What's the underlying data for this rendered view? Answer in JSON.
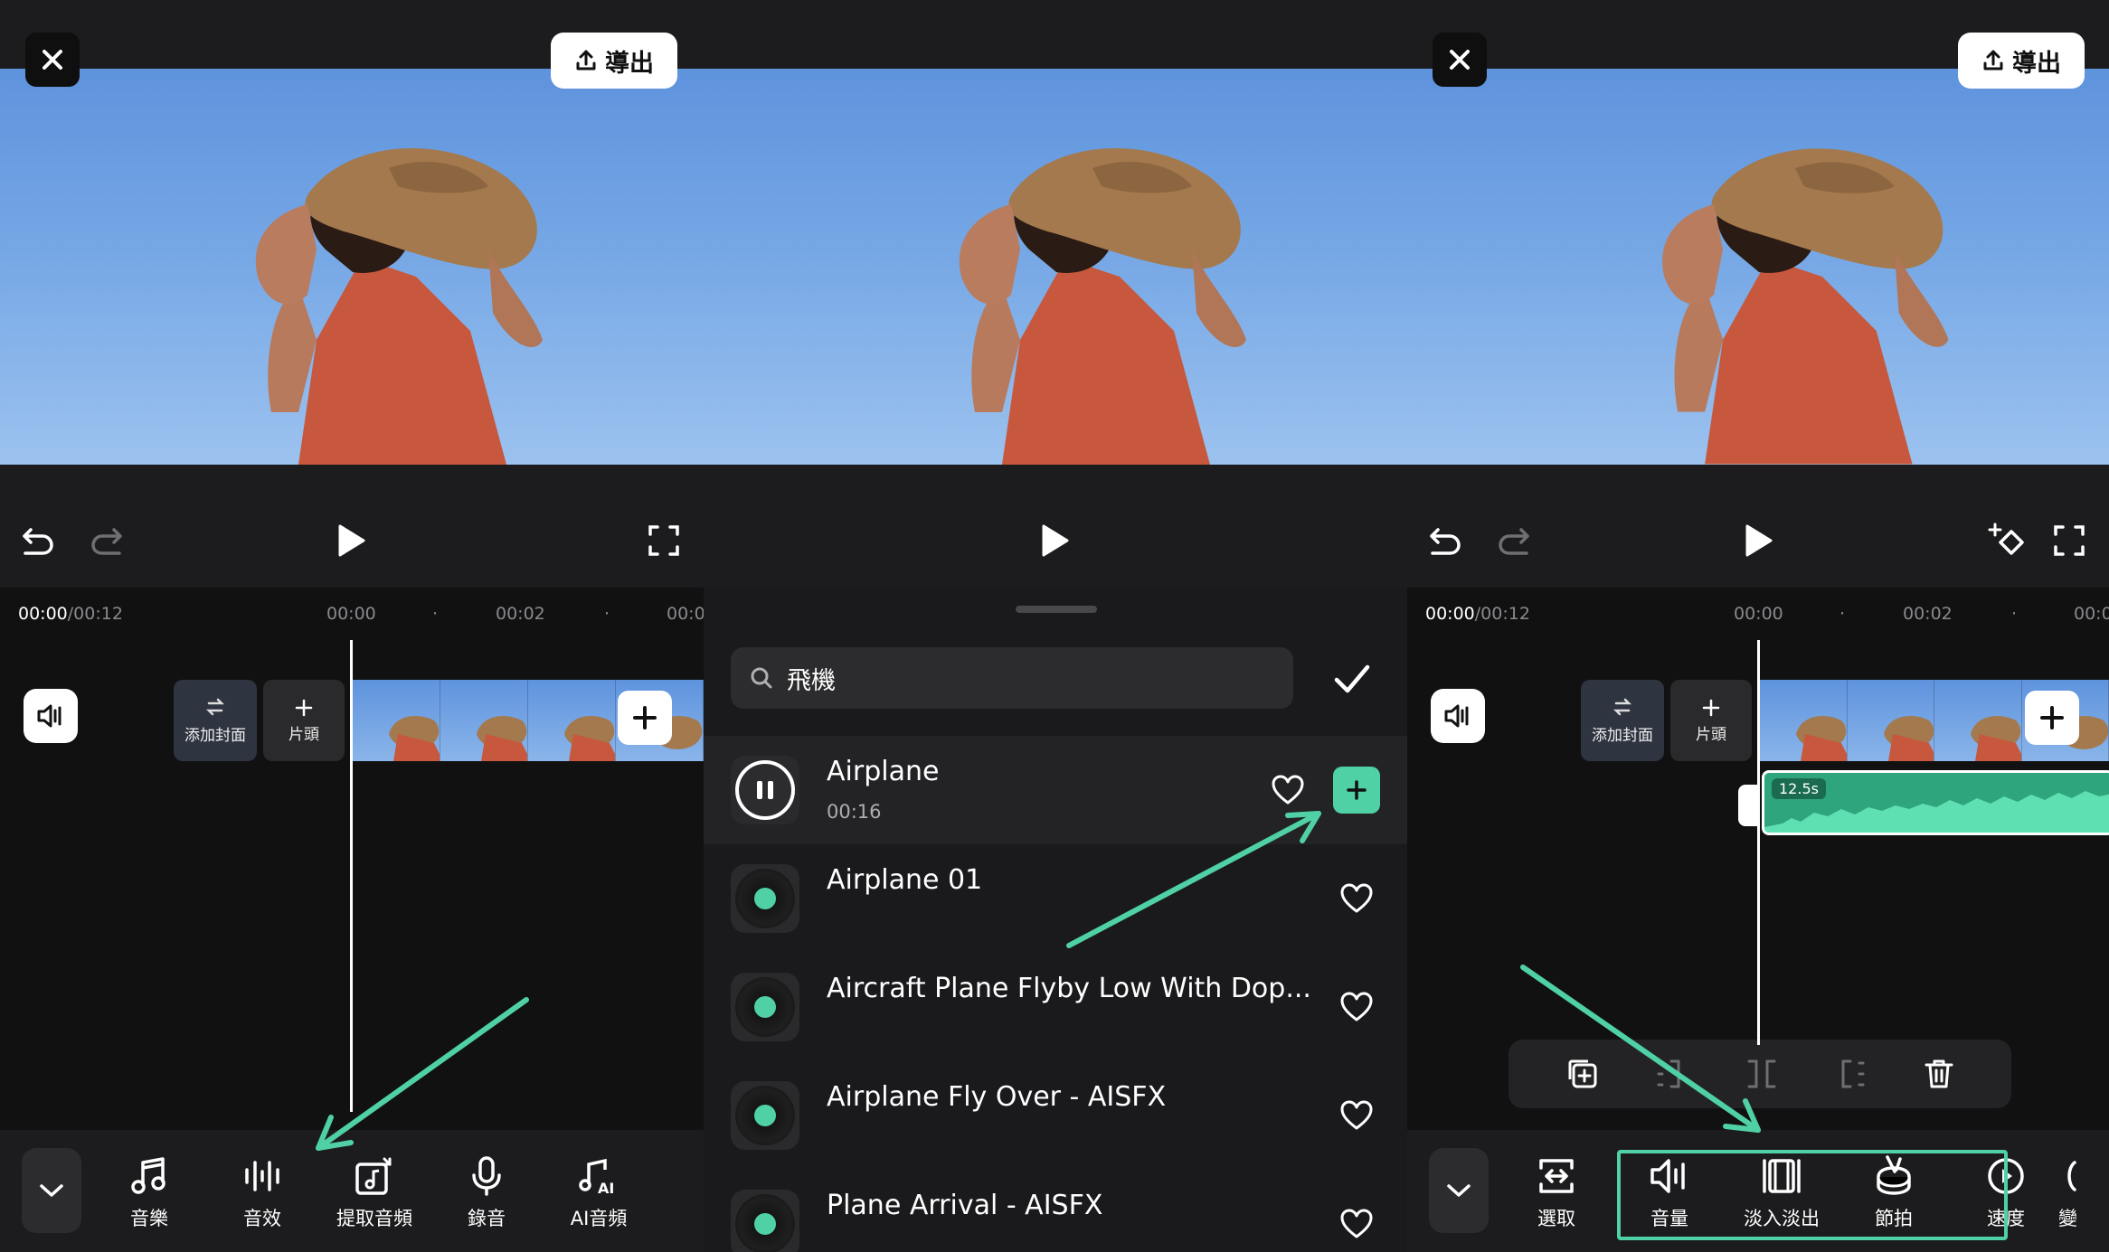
{
  "panel1": {
    "export_label": "導出",
    "time_current": "00:00",
    "time_total": "/00:12",
    "ticks": [
      "00:00",
      "·",
      "00:02",
      "·",
      "00:0"
    ],
    "cover_label": "添加封面",
    "opening_label": "片頭",
    "tools": [
      {
        "label": "音樂",
        "icon": "music-note-icon"
      },
      {
        "label": "音效",
        "icon": "sound-effect-icon"
      },
      {
        "label": "提取音頻",
        "icon": "extract-audio-icon"
      },
      {
        "label": "錄音",
        "icon": "microphone-icon"
      },
      {
        "label": "AI音頻",
        "icon": "ai-audio-icon"
      }
    ]
  },
  "panel2": {
    "search_value": "飛機",
    "results": [
      {
        "title": "Airplane",
        "duration": "00:16",
        "state": "playing"
      },
      {
        "title": "Airplane 01",
        "duration": "",
        "state": "idle"
      },
      {
        "title": "Aircraft Plane Flyby Low With Dop...",
        "duration": "",
        "state": "idle"
      },
      {
        "title": "Airplane Fly Over - AISFX",
        "duration": "",
        "state": "idle"
      },
      {
        "title": "Plane Arrival - AISFX",
        "duration": "",
        "state": "idle"
      }
    ]
  },
  "panel3": {
    "export_label": "導出",
    "time_current": "00:00",
    "time_total": "/00:12",
    "ticks": [
      "00:00",
      "·",
      "00:02",
      "·",
      "00:0"
    ],
    "cover_label": "添加封面",
    "opening_label": "片頭",
    "audio_length": "12.5s",
    "tools": [
      {
        "label": "選取",
        "icon": "select-icon"
      },
      {
        "label": "音量",
        "icon": "volume-icon"
      },
      {
        "label": "淡入淡出",
        "icon": "fade-icon"
      },
      {
        "label": "節拍",
        "icon": "beat-icon"
      },
      {
        "label": "速度",
        "icon": "speed-icon"
      },
      {
        "label": "變",
        "icon": "more-icon"
      }
    ]
  },
  "colors": {
    "accent": "#4fd1a5",
    "sky": "#78a9e6",
    "dark": "#141414"
  }
}
